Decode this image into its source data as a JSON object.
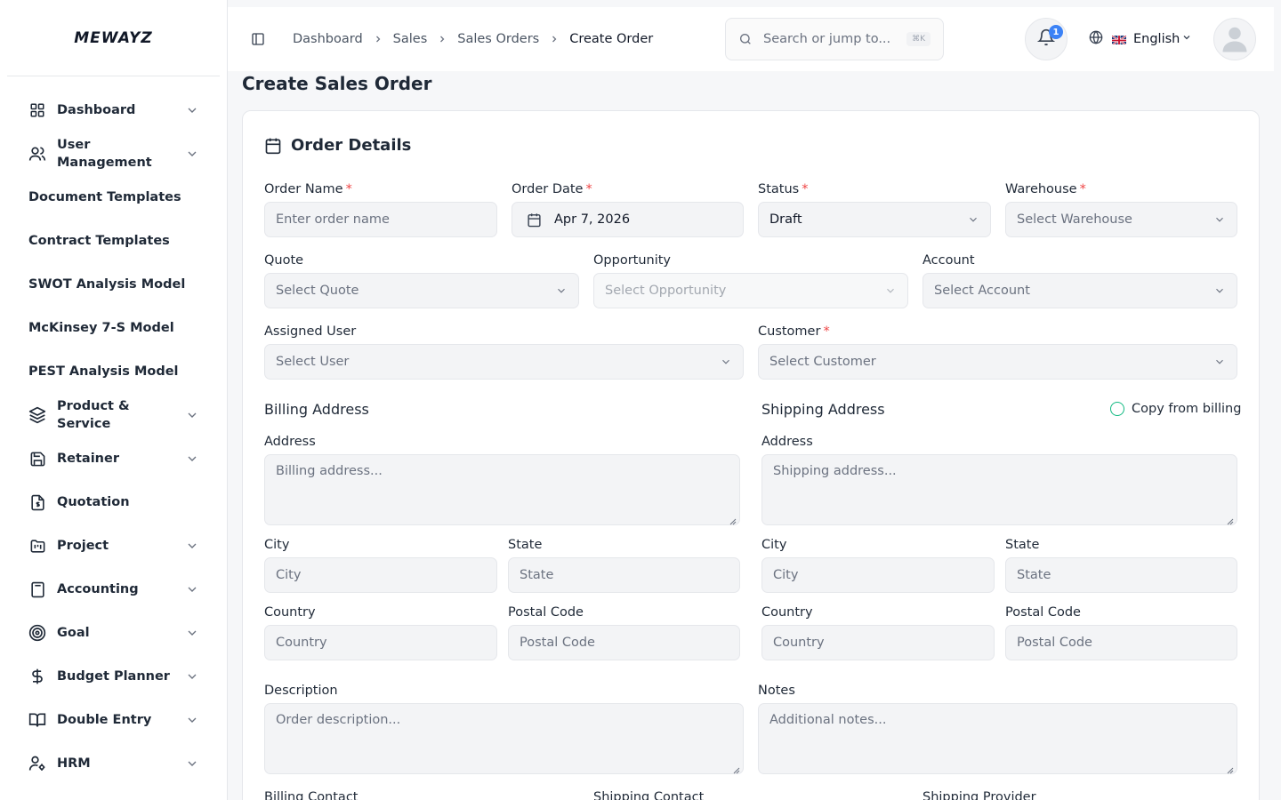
{
  "brand": {
    "logo": "MEWAYZ"
  },
  "sidebar": {
    "items": [
      {
        "label": "Dashboard",
        "icon": "grid-icon",
        "has_children": true
      },
      {
        "label": "User Management",
        "icon": "users-icon",
        "has_children": true
      },
      {
        "label": "Document Templates",
        "icon": "",
        "has_children": false
      },
      {
        "label": "Contract Templates",
        "icon": "",
        "has_children": false
      },
      {
        "label": "SWOT Analysis Model",
        "icon": "",
        "has_children": false
      },
      {
        "label": "McKinsey 7-S Model",
        "icon": "",
        "has_children": false
      },
      {
        "label": "PEST Analysis Model",
        "icon": "",
        "has_children": false
      },
      {
        "label": "Product & Service",
        "icon": "layers-icon",
        "has_children": true
      },
      {
        "label": "Retainer",
        "icon": "save-icon",
        "has_children": true
      },
      {
        "label": "Quotation",
        "icon": "file-dollar-icon",
        "has_children": false
      },
      {
        "label": "Project",
        "icon": "folder-kanban-icon",
        "has_children": true
      },
      {
        "label": "Accounting",
        "icon": "calculator-icon",
        "has_children": true
      },
      {
        "label": "Goal",
        "icon": "target-icon",
        "has_children": true
      },
      {
        "label": "Budget Planner",
        "icon": "dollar-icon",
        "has_children": true
      },
      {
        "label": "Double Entry",
        "icon": "book-icon",
        "has_children": true
      },
      {
        "label": "HRM",
        "icon": "user-cog-icon",
        "has_children": true
      }
    ]
  },
  "header": {
    "breadcrumbs": [
      "Dashboard",
      "Sales",
      "Sales Orders",
      "Create Order"
    ],
    "search_placeholder": "Search or jump to...",
    "search_shortcut": "⌘K",
    "notifications_count": "1",
    "language": "English"
  },
  "page": {
    "title": "Create Sales Order"
  },
  "form": {
    "section_title": "Order Details",
    "order_name": {
      "label": "Order Name",
      "placeholder": "Enter order name"
    },
    "order_date": {
      "label": "Order Date",
      "value": "Apr 7, 2026"
    },
    "status": {
      "label": "Status",
      "value": "Draft"
    },
    "warehouse": {
      "label": "Warehouse",
      "placeholder": "Select Warehouse"
    },
    "quote": {
      "label": "Quote",
      "placeholder": "Select Quote"
    },
    "opportunity": {
      "label": "Opportunity",
      "placeholder": "Select Opportunity"
    },
    "account": {
      "label": "Account",
      "placeholder": "Select Account"
    },
    "assigned_user": {
      "label": "Assigned User",
      "placeholder": "Select User"
    },
    "customer": {
      "label": "Customer",
      "placeholder": "Select Customer"
    },
    "billing": {
      "heading": "Billing Address",
      "address_label": "Address",
      "address_placeholder": "Billing address...",
      "city_label": "City",
      "city_placeholder": "City",
      "state_label": "State",
      "state_placeholder": "State",
      "country_label": "Country",
      "country_placeholder": "Country",
      "postal_label": "Postal Code",
      "postal_placeholder": "Postal Code"
    },
    "shipping": {
      "heading": "Shipping Address",
      "copy_label": "Copy from billing",
      "address_label": "Address",
      "address_placeholder": "Shipping address...",
      "city_label": "City",
      "city_placeholder": "City",
      "state_label": "State",
      "state_placeholder": "State",
      "country_label": "Country",
      "country_placeholder": "Country",
      "postal_label": "Postal Code",
      "postal_placeholder": "Postal Code"
    },
    "description": {
      "label": "Description",
      "placeholder": "Order description..."
    },
    "notes": {
      "label": "Notes",
      "placeholder": "Additional notes..."
    },
    "billing_contact": {
      "label": "Billing Contact"
    },
    "shipping_contact": {
      "label": "Shipping Contact"
    },
    "shipping_provider": {
      "label": "Shipping Provider"
    }
  },
  "colors": {
    "required": "#ef4444",
    "accent": "#3b82f6",
    "radio": "#10b981"
  }
}
